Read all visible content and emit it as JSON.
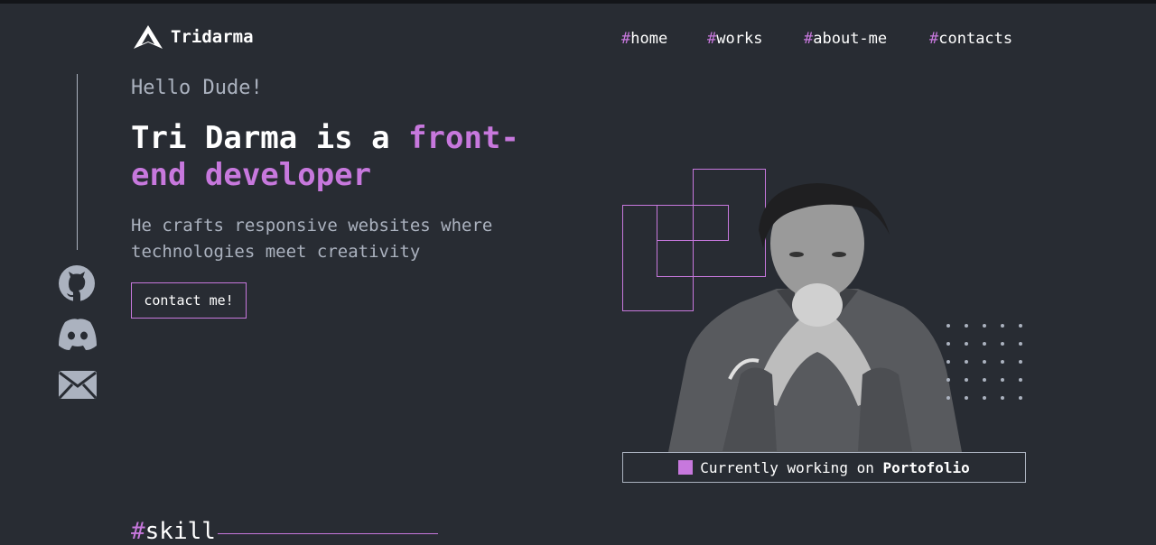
{
  "brand": {
    "logo_icon": "triangle-logo-icon",
    "name": "Tridarma"
  },
  "nav": {
    "items": [
      {
        "hash": "#",
        "label": "home"
      },
      {
        "hash": "#",
        "label": "works"
      },
      {
        "hash": "#",
        "label": "about-me"
      },
      {
        "hash": "#",
        "label": "contacts"
      }
    ]
  },
  "social": {
    "icons": [
      "github-icon",
      "discord-icon",
      "email-icon"
    ]
  },
  "hero": {
    "greeting": "Hello Dude!",
    "headline_prefix": "Tri Darma is a ",
    "headline_accent": "front-end developer",
    "subtitle": "He crafts responsive websites where technologies meet creativity",
    "cta_label": "contact me!"
  },
  "status": {
    "prefix": "Currently working on ",
    "project": "Portofolio"
  },
  "skills": {
    "hash": "#",
    "label": "skill"
  },
  "colors": {
    "background": "#282c33",
    "accent": "#c778dd",
    "muted_text": "#abb2bf",
    "text": "#ffffff"
  }
}
